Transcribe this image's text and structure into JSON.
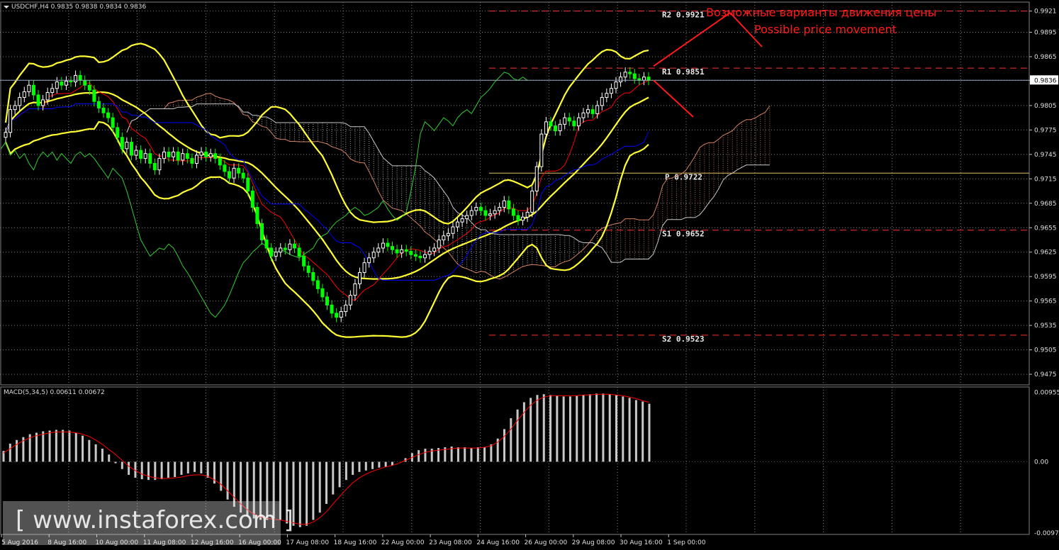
{
  "window": {
    "symbol_info": "USDCHF,H4  0.9835 0.9838 0.9834 0.9836",
    "macd_info": "MACD(5,34,5) 0.00611 0.00672"
  },
  "annotations": {
    "forecast_ru": "Возможные варианты движения цены",
    "forecast_en": "Possible price movement"
  },
  "watermark": "[ www.instaforex.com ]",
  "colors": {
    "background": "#000000",
    "grid": "#7f7f7f",
    "candle_up": "#ffffff",
    "candle_down": "#00ff00",
    "bollinger": "#ffff33",
    "tenkan": "#ff0000",
    "kijun": "#0000ff",
    "chikou": "#33cc33",
    "pivot_lines": "#ff3030",
    "forecast": "#ff1a1a",
    "macd_hist": "#c8c8c8",
    "macd_signal": "#ff0000"
  },
  "chart_data": {
    "type": "candlestick",
    "price_axis": {
      "ticks": [
        "0.9921",
        "0.9895",
        "0.9865",
        "0.9836",
        "0.9805",
        "0.9775",
        "0.9745",
        "0.9715",
        "0.9685",
        "0.9655",
        "0.9625",
        "0.9595",
        "0.9565",
        "0.9535",
        "0.9505",
        "0.9475"
      ],
      "current_price": "0.9836",
      "ylim": [
        0.9462,
        0.9932
      ]
    },
    "macd_axis": {
      "ticks": [
        "0.00955",
        "0.00",
        "-0.00979"
      ],
      "ylim": [
        -0.01,
        0.0103
      ]
    },
    "time_axis": {
      "labels": [
        "5 Aug 2016",
        "8 Aug 16:00",
        "10 Aug 00:00",
        "11 Aug 08:00",
        "12 Aug 16:00",
        "16 Aug 00:00",
        "17 Aug 08:00",
        "18 Aug 16:00",
        "22 Aug 00:00",
        "23 Aug 08:00",
        "24 Aug 16:00",
        "26 Aug 00:00",
        "29 Aug 08:00",
        "30 Aug 16:00",
        "1 Sep 00:00"
      ]
    },
    "levels": [
      {
        "name": "R2",
        "label": "R2  0.9921",
        "value": 0.9921,
        "style": "dashed"
      },
      {
        "name": "R1",
        "label": "R1  0.9851",
        "value": 0.9851,
        "style": "dashed"
      },
      {
        "name": "P",
        "label": "P  0.9722",
        "value": 0.9722,
        "style": "solid"
      },
      {
        "name": "S1",
        "label": "S1  0.9652",
        "value": 0.9652,
        "style": "dashed"
      },
      {
        "name": "S2",
        "label": "S2  0.9523",
        "value": 0.9523,
        "style": "dashed"
      }
    ],
    "candles_close": [
      0.9772,
      0.98,
      0.9805,
      0.9815,
      0.9822,
      0.983,
      0.9818,
      0.9805,
      0.9812,
      0.9821,
      0.9826,
      0.9834,
      0.983,
      0.9835,
      0.9834,
      0.9842,
      0.9836,
      0.983,
      0.9824,
      0.981,
      0.9802,
      0.9796,
      0.979,
      0.9778,
      0.9766,
      0.9752,
      0.976,
      0.9744,
      0.975,
      0.974,
      0.9746,
      0.9734,
      0.9726,
      0.974,
      0.9748,
      0.9742,
      0.9748,
      0.9738,
      0.9746,
      0.974,
      0.9734,
      0.9744,
      0.9748,
      0.9742,
      0.9746,
      0.974,
      0.9732,
      0.9724,
      0.9716,
      0.9728,
      0.9722,
      0.9716,
      0.97,
      0.968,
      0.966,
      0.964,
      0.963,
      0.962,
      0.9625,
      0.963,
      0.9628,
      0.9635,
      0.963,
      0.962,
      0.9608,
      0.96,
      0.959,
      0.958,
      0.957,
      0.956,
      0.955,
      0.9545,
      0.9552,
      0.956,
      0.9572,
      0.9586,
      0.96,
      0.9612,
      0.9618,
      0.9625,
      0.963,
      0.9636,
      0.9632,
      0.9628,
      0.9624,
      0.9628,
      0.9626,
      0.9622,
      0.962,
      0.9618,
      0.9622,
      0.9626,
      0.963,
      0.964,
      0.9645,
      0.9648,
      0.9656,
      0.9662,
      0.9666,
      0.967,
      0.9676,
      0.968,
      0.9676,
      0.967,
      0.9672,
      0.9676,
      0.968,
      0.9688,
      0.9678,
      0.967,
      0.9664,
      0.9668,
      0.9674,
      0.97,
      0.973,
      0.977,
      0.9785,
      0.978,
      0.9774,
      0.9782,
      0.979,
      0.9786,
      0.978,
      0.979,
      0.9796,
      0.98,
      0.9795,
      0.9805,
      0.9815,
      0.982,
      0.9826,
      0.9834,
      0.984,
      0.9846,
      0.9844,
      0.9838,
      0.9836,
      0.984,
      0.9836
    ],
    "macd_hist": [
      0.0015,
      0.0025,
      0.003,
      0.0034,
      0.0038,
      0.004,
      0.0042,
      0.0043,
      0.0044,
      0.0044,
      0.0043,
      0.004,
      0.0036,
      0.003,
      0.0024,
      0.0018,
      0.001,
      -0.0002,
      -0.001,
      -0.0018,
      -0.0022,
      -0.0024,
      -0.0025,
      -0.0025,
      -0.0024,
      -0.0022,
      -0.0021,
      -0.0018,
      -0.0016,
      -0.0014,
      -0.0016,
      -0.0022,
      -0.003,
      -0.004,
      -0.0052,
      -0.0062,
      -0.007,
      -0.0075,
      -0.0078,
      -0.008,
      -0.008,
      -0.0078,
      -0.008,
      -0.0085,
      -0.0088,
      -0.009,
      -0.0088,
      -0.008,
      -0.007,
      -0.0058,
      -0.0045,
      -0.0035,
      -0.0025,
      -0.0018,
      -0.0014,
      -0.0012,
      -0.001,
      -0.0008,
      -0.0007,
      -0.0005,
      0.0,
      0.0005,
      0.0012,
      0.0016,
      0.0018,
      0.0018,
      0.0019,
      0.002,
      0.0021,
      0.002,
      0.002,
      0.0019,
      0.002,
      0.002,
      0.0024,
      0.0032,
      0.0045,
      0.006,
      0.0072,
      0.0082,
      0.0088,
      0.0092,
      0.0093,
      0.0092,
      0.0091,
      0.009,
      0.009,
      0.0091,
      0.0092,
      0.0093,
      0.0094,
      0.0094,
      0.0093,
      0.0092,
      0.009,
      0.0088,
      0.0085,
      0.0083,
      0.008
    ],
    "macd_signal": [
      0.0012,
      0.0018,
      0.0024,
      0.0029,
      0.0033,
      0.0036,
      0.0038,
      0.004,
      0.0041,
      0.0041,
      0.0041,
      0.004,
      0.0038,
      0.0035,
      0.003,
      0.0024,
      0.0017,
      0.001,
      0.0002,
      -0.0006,
      -0.0012,
      -0.0017,
      -0.002,
      -0.0022,
      -0.0023,
      -0.0023,
      -0.0022,
      -0.0021,
      -0.0019,
      -0.0018,
      -0.0018,
      -0.002,
      -0.0025,
      -0.0031,
      -0.004,
      -0.0049,
      -0.0058,
      -0.0066,
      -0.0072,
      -0.0076,
      -0.0078,
      -0.0079,
      -0.008,
      -0.0082,
      -0.0084,
      -0.0086,
      -0.0086,
      -0.0083,
      -0.0077,
      -0.0069,
      -0.0058,
      -0.0048,
      -0.0038,
      -0.0029,
      -0.0022,
      -0.0017,
      -0.0013,
      -0.001,
      -0.0007,
      -0.0005,
      -0.0002,
      0.0002,
      0.0006,
      0.001,
      0.0013,
      0.0015,
      0.0016,
      0.0017,
      0.0018,
      0.0019,
      0.0019,
      0.0019,
      0.0019,
      0.002,
      0.0022,
      0.0027,
      0.0035,
      0.0045,
      0.0057,
      0.0068,
      0.0078,
      0.0085,
      0.0089,
      0.0091,
      0.0091,
      0.0091,
      0.0091,
      0.0091,
      0.0092,
      0.0092,
      0.0093,
      0.0093,
      0.0093,
      0.0092,
      0.0091,
      0.0089,
      0.0087,
      0.0084,
      0.0082
    ]
  }
}
